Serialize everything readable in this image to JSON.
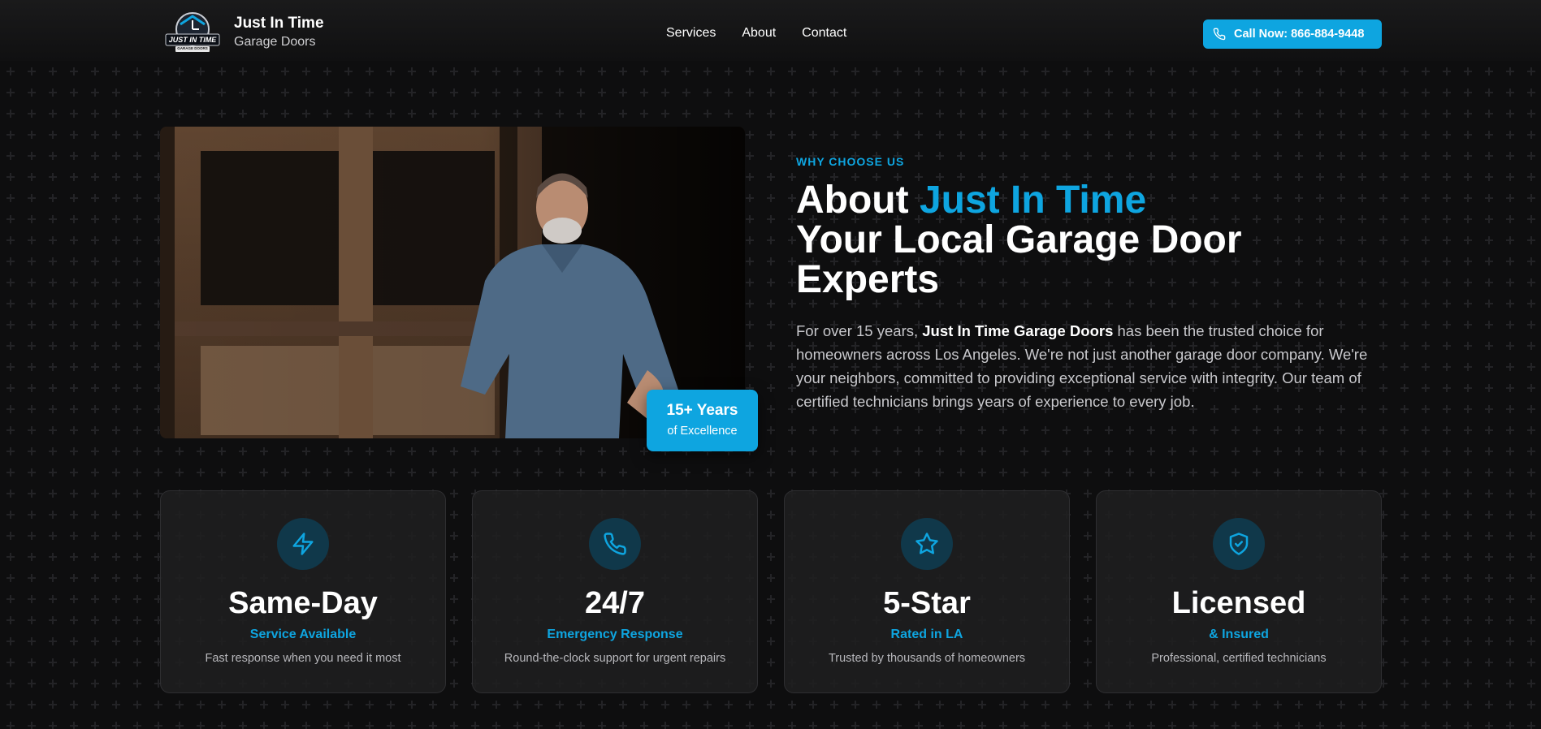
{
  "header": {
    "logo_title": "Just In Time",
    "logo_subtitle": "Garage Doors",
    "logo_badge_text": "JUST IN TIME",
    "logo_badge_small": "GARAGE DOORS",
    "nav": [
      "Services",
      "About",
      "Contact"
    ],
    "cta_label": "Call Now: 866-884-9448"
  },
  "hero": {
    "badge_big": "15+ Years",
    "badge_small": "of Excellence",
    "eyebrow": "WHY CHOOSE US",
    "headline_prefix": "About ",
    "headline_accent": "Just In Time",
    "headline_line2": "Your Local Garage Door",
    "headline_line3": "Experts",
    "para_1": "For over 15 years, ",
    "para_bold": "Just In Time Garage Doors",
    "para_2": " has been the trusted choice for homeowners across Los Angeles. We're not just another garage door company. We're your neighbors, committed to providing exceptional service with integrity. Our team of certified technicians brings years of experience to every job."
  },
  "features": [
    {
      "icon": "lightning-icon",
      "title": "Same-Day",
      "sub": "Service Available",
      "desc": "Fast response when you need it most"
    },
    {
      "icon": "phone-icon",
      "title": "24/7",
      "sub": "Emergency Response",
      "desc": "Round-the-clock support for urgent repairs"
    },
    {
      "icon": "star-icon",
      "title": "5-Star",
      "sub": "Rated in LA",
      "desc": "Trusted by thousands of homeowners"
    },
    {
      "icon": "shield-check-icon",
      "title": "Licensed",
      "sub": "& Insured",
      "desc": "Professional, certified technicians"
    }
  ],
  "colors": {
    "accent": "#0ea5e0",
    "background": "#0e0e0f",
    "card": "#1e1e20"
  }
}
